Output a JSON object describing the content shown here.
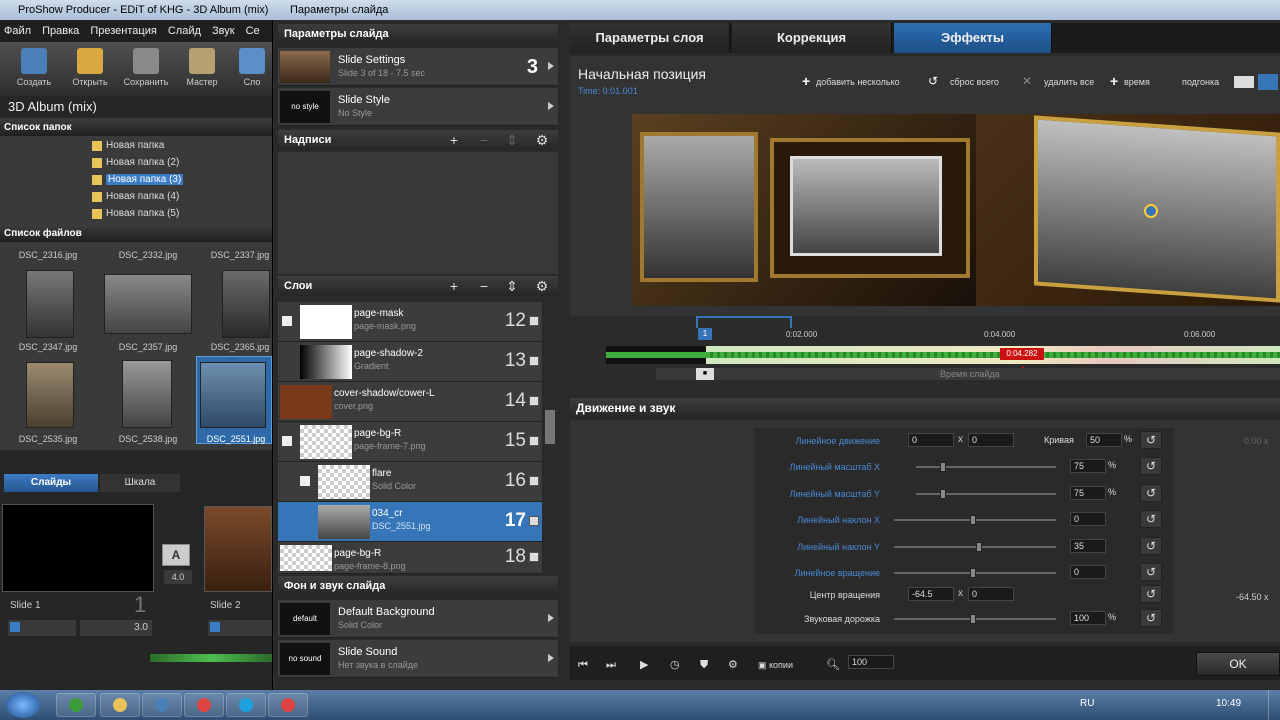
{
  "bg_window": {
    "title": "ProShow Producer - EDiT of KHG - 3D Album (mix)",
    "menu": [
      "Файл",
      "Правка",
      "Презентация",
      "Слайд",
      "Звук",
      "Се"
    ],
    "toolbar": [
      "Создать",
      "Открыть",
      "Сохранить",
      "Мастер",
      "Сло"
    ],
    "project_name": "3D Album (mix)",
    "folders_header": "Список папок",
    "folders": [
      "Новая папка",
      "Новая папка (2)",
      "Новая папка (3)",
      "Новая папка (4)",
      "Новая папка (5)"
    ],
    "files_header": "Список файлов",
    "files": [
      "DSC_2316.jpg",
      "DSC_2332.jpg",
      "DSC_2337.jpg",
      "DSC_2347.jpg",
      "DSC_2357.jpg",
      "DSC_2365.jpg",
      "DSC_2535.jpg",
      "DSC_2538.jpg",
      "DSC_2551.jpg"
    ],
    "tab_slides": "Слайды",
    "tab_scale": "Шкала",
    "slide1_label": "Slide 1",
    "slide1_num": "1",
    "slide1_time": "3.0",
    "trans_time": "4.0",
    "slide2_label": "Slide 2"
  },
  "dialog": {
    "title": "Параметры слайда",
    "left": {
      "slide_params_hdr": "Параметры слайда",
      "slide_settings_title": "Slide Settings",
      "slide_settings_sub": "Slide 3 of 18 - 7.5 sec",
      "slide_settings_num": "3",
      "slide_style_thumb": "no style",
      "slide_style_title": "Slide Style",
      "slide_style_sub": "No Style",
      "captions_hdr": "Надписи",
      "layers_hdr": "Слои",
      "layers": [
        {
          "name": "page-mask",
          "sub": "page-mask.png",
          "num": "12"
        },
        {
          "name": "page-shadow-2",
          "sub": "Gradient",
          "num": "13"
        },
        {
          "name": "cover-shadow/cower-L",
          "sub": "cover.png",
          "num": "14"
        },
        {
          "name": "page-bg-R",
          "sub": "page-frame-7.png",
          "num": "15"
        },
        {
          "name": "flare",
          "sub": "Solid Color",
          "num": "16"
        },
        {
          "name": "034_cr",
          "sub": "DSC_2551.jpg",
          "num": "17"
        },
        {
          "name": "page-bg-R",
          "sub": "page-frame-8.png",
          "num": "18"
        }
      ],
      "bg_sound_hdr": "Фон и звук слайда",
      "bg_thumb": "default",
      "bg_title": "Default Background",
      "bg_sub": "Solid Color",
      "sound_thumb": "no sound",
      "sound_title": "Slide Sound",
      "sound_sub": "Нет звука в слайде"
    },
    "tabs": [
      "Параметры слоя",
      "Коррекция",
      "Эффекты"
    ],
    "active_tab": "Эффекты",
    "position_title": "Начальная позиция",
    "position_time": "Time: 0:01.001",
    "tools": {
      "add_several": "добавить несколько",
      "reset_all": "сброс всего",
      "delete_all": "удалить все",
      "time": "время",
      "fit": "подгонка"
    },
    "timeline": {
      "ticks": [
        "0:02.000",
        "0:04.000",
        "0:06.000"
      ],
      "marker": "0:04.282",
      "start_label": "1",
      "label": "Время слайда"
    },
    "motion_hdr": "Движение и звук",
    "motion": {
      "linear_move": "Линейное движение",
      "move_x": "0",
      "move_y": "0",
      "curve_label": "Кривая",
      "curve_val": "50",
      "scale_x_label": "Линейный масштаб X",
      "scale_x": "75",
      "scale_y_label": "Линейный масштаб Y",
      "scale_y": "75",
      "tilt_x_label": "Линейный наклон X",
      "tilt_x": "0",
      "tilt_y_label": "Линейный наклон Y",
      "tilt_y": "35",
      "rot_label": "Линейное вращение",
      "rot": "0",
      "center_label": "Центр вращения",
      "center_x": "-64.5",
      "center_y": "0",
      "audio_label": "Звуковая дорожка",
      "audio": "100",
      "right_top": "0.00 x",
      "right_center": "-64.50 x"
    },
    "bottom": {
      "copy": "копии",
      "zoom": "100",
      "ok": "OK"
    }
  },
  "taskbar": {
    "lang": "RU",
    "clock": "10:49"
  }
}
